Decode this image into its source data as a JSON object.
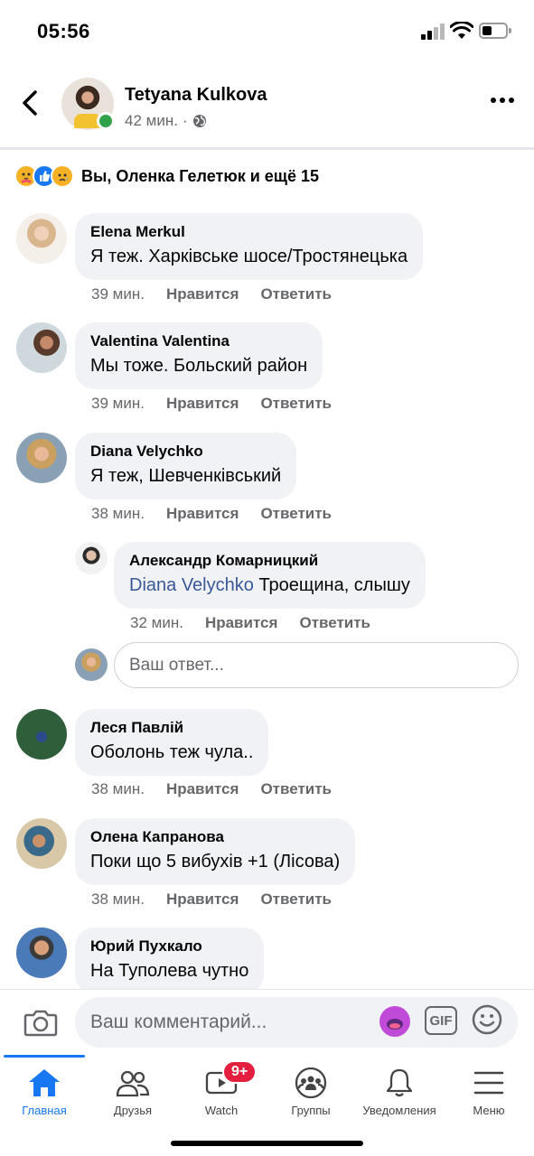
{
  "status_bar": {
    "time": "05:56",
    "signal_bars": 2,
    "battery_level": 0.3
  },
  "post": {
    "author": "Tetyana Kulkova",
    "time": "42 мин.",
    "separator": "·",
    "privacy_icon": "globe-icon",
    "online": true
  },
  "reactions": {
    "icons": [
      "care-reaction-icon",
      "like-reaction-icon",
      "sad-reaction-icon"
    ],
    "text": "Вы, Оленка Гелетюк и ещё 15"
  },
  "comments": [
    {
      "name": "Elena Merkul",
      "text": "Я теж. Харківське шосе/Тростянецька",
      "time": "39 мин.",
      "like": "Нравится",
      "reply": "Ответить"
    },
    {
      "name": "Valentina Valentina",
      "text": "Мы тоже. Больский район",
      "time": "39 мин.",
      "like": "Нравится",
      "reply": "Ответить"
    },
    {
      "name": "Diana Velychko",
      "text": "Я теж, Шевченківський",
      "time": "38 мин.",
      "like": "Нравится",
      "reply": "Ответить"
    },
    {
      "name": "Александр Комарницкий",
      "mention": "Diana Velychko",
      "text": "Троещина, слышу",
      "time": "32 мин.",
      "like": "Нравится",
      "reply": "Ответить",
      "is_reply": true
    },
    {
      "name": "Леся Павлій",
      "text": "Оболонь теж чула..",
      "time": "38 мин.",
      "like": "Нравится",
      "reply": "Ответить"
    },
    {
      "name": "Олена Капранова",
      "text": "Поки що 5 вибухів +1 (Лісова)",
      "time": "38 мин.",
      "like": "Нравится",
      "reply": "Ответить"
    },
    {
      "name": "Юрий Пухкало",
      "text": "На Туполева чутно"
    }
  ],
  "reply_field": {
    "placeholder": "Ваш ответ..."
  },
  "composer": {
    "placeholder": "Ваш комментарий...",
    "gif_label": "GIF"
  },
  "tabs": [
    {
      "label": "Главная",
      "icon": "home-icon",
      "active": true
    },
    {
      "label": "Друзья",
      "icon": "friends-icon"
    },
    {
      "label": "Watch",
      "icon": "watch-icon",
      "badge": "9+"
    },
    {
      "label": "Группы",
      "icon": "groups-icon"
    },
    {
      "label": "Уведомления",
      "icon": "bell-icon"
    },
    {
      "label": "Меню",
      "icon": "menu-icon"
    }
  ],
  "colors": {
    "accent": "#1877f2",
    "bubble": "#f0f2f5",
    "secondary_text": "#65676b",
    "online": "#31a24c",
    "badge": "#e41e3f",
    "mention": "#385898"
  }
}
